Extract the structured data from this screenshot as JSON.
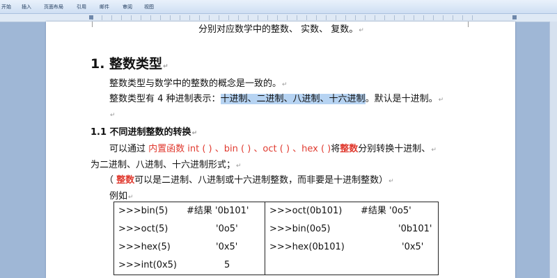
{
  "menu": {
    "tabs": [
      "开始",
      "插入",
      "页面布局",
      "引用",
      "邮件",
      "审阅",
      "视图"
    ]
  },
  "doc": {
    "top_line": "分别对应数学中的整数、     实数、     复数。",
    "h1": "1.  整数类型",
    "p1": "整数类型与数学中的整数的概念是一致的。",
    "p2_pre": "整数类型有  4  种进制表示：",
    "p2_sel": "十进制、二进制、八进制、十六进制",
    "p2_post": "。默认是十进制。",
    "h2": "1.1  不同进制整数的转换",
    "p3_pre": "可以通过 ",
    "p3_red": "内置函数 int ( ) 、bin ( ) 、oct ( ) 、hex ( )",
    "p3_mid": "将",
    "p3_bold": "整数",
    "p3_post": "分别转换十进制、",
    "p4": "为二进制、八进制、十六进制形式；",
    "p5_pre": "（ ",
    "p5_bold": "整数",
    "p5_post": "可以是二进制、八进制或十六进制整数，而非要是十进制整数）",
    "p6": "例如",
    "return_mark": "↵",
    "left_rows": [
      {
        "code": ">>>bin(5)",
        "result": "#结果  '0b101'"
      },
      {
        "code": ">>>oct(5)",
        "result": "'0o5'"
      },
      {
        "code": ">>>hex(5)",
        "result": "'0x5'"
      },
      {
        "code": ">>>int(0x5)",
        "result": "5"
      }
    ],
    "right_rows": [
      {
        "code": ">>>oct(0b101)",
        "result": "#结果  '0o5'"
      },
      {
        "code": ">>>bin(0o5)",
        "result": "'0b101'"
      },
      {
        "code": ">>>hex(0b101)",
        "result": "'0x5'"
      }
    ]
  }
}
